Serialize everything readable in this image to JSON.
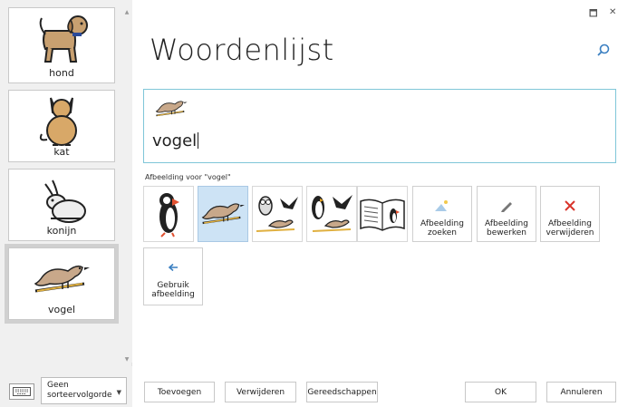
{
  "window": {
    "minimize_symbol": "🗖",
    "close_symbol": "✕"
  },
  "sidebar": {
    "items": [
      {
        "label": "hond",
        "icon": "dog-icon"
      },
      {
        "label": "kat",
        "icon": "cat-icon"
      },
      {
        "label": "konijn",
        "icon": "rabbit-icon"
      },
      {
        "label": "vogel",
        "icon": "bird-icon",
        "selected": true
      }
    ],
    "sort_label": "Geen sorteervolgorde"
  },
  "main": {
    "title": "Woordenlijst",
    "entry": {
      "word": "vogel",
      "icon": "bird-icon"
    },
    "image_caption": "Afbeelding voor \"vogel\"",
    "image_options": [
      {
        "icon": "puffin-icon"
      },
      {
        "icon": "bird-icon",
        "selected": true
      },
      {
        "icon": "birds-group-icon"
      },
      {
        "icon": "penguin-birds-icon"
      },
      {
        "icon": "bird-book-icon"
      }
    ],
    "actions": {
      "search": "Afbeelding zoeken",
      "edit": "Afbeelding bewerken",
      "delete": "Afbeelding verwijderen",
      "use": "Gebruik afbeelding"
    }
  },
  "footer": {
    "add": "Toevoegen",
    "remove": "Verwijderen",
    "tools": "Gereedschappen",
    "ok": "OK",
    "cancel": "Annuleren"
  },
  "colors": {
    "accent": "#3a7fc1",
    "entry_border": "#7fc6d8",
    "selected_tile": "#cde3f5",
    "delete_red": "#d9342b",
    "bird_brown": "#c8a88a",
    "branch": "#e0b040"
  }
}
